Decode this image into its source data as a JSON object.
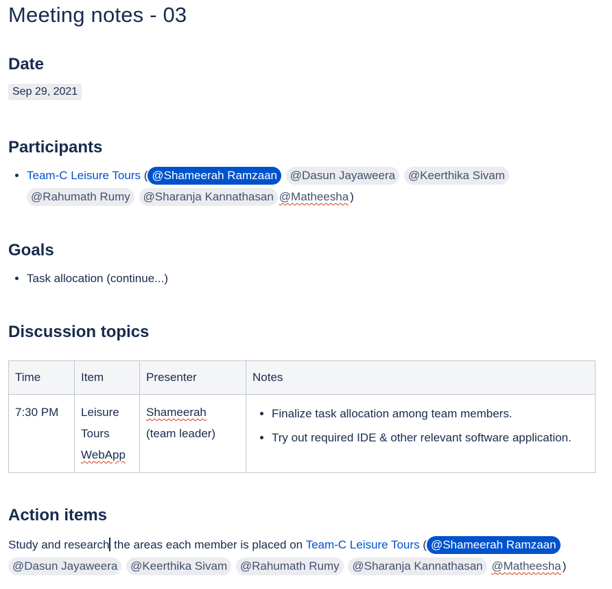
{
  "title": "Meeting notes - 03",
  "date_section": {
    "heading": "Date",
    "value": "Sep 29, 2021"
  },
  "participants": {
    "heading": "Participants",
    "team_link": "Team-C Leisure Tours",
    "open_paren": " (",
    "close_paren": ")",
    "mentions": [
      "@Shameerah Ramzaan",
      "@Dasun Jayaweera",
      "@Keerthika Sivam",
      "@Rahumath Rumy",
      "@Sharanja Kannathasan",
      "@Matheesha"
    ]
  },
  "goals": {
    "heading": "Goals",
    "items": [
      "Task allocation (continue...)"
    ]
  },
  "discussion": {
    "heading": "Discussion topics",
    "columns": [
      "Time",
      "Item",
      "Presenter",
      "Notes"
    ],
    "rows": [
      {
        "time": "7:30 PM",
        "item_line1": "Leisure",
        "item_line2": "Tours",
        "item_line3": "WebApp",
        "presenter_line1": "Shameerah",
        "presenter_line2": "(team leader)",
        "notes": [
          "Finalize task allocation among team members.",
          "Try out required IDE & other relevant software application."
        ]
      }
    ]
  },
  "action_items": {
    "heading": "Action items",
    "text_before_cursor": "Study and research",
    "text_after_cursor": " the areas each member is placed on ",
    "team_link": "Team-C Leisure Tours",
    "open_paren": " (",
    "close_paren": ")",
    "mentions": [
      "@Shameerah Ramzaan",
      "@Dasun Jayaweera",
      "@Keerthika Sivam",
      "@Rahumath Rumy",
      "@Sharanja Kannathasan",
      "@Matheesha"
    ]
  },
  "colors": {
    "link": "#0052cc",
    "self_mention_bg": "#0052cc",
    "mention_bg": "#ebecf0",
    "text": "#172b4d"
  }
}
